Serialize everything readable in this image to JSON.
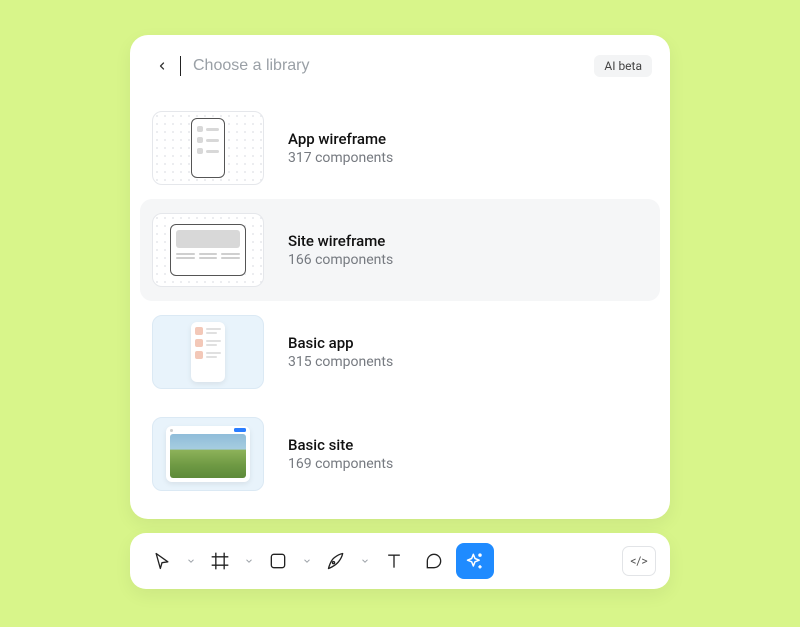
{
  "header": {
    "placeholder": "Choose a library",
    "beta_label": "AI beta"
  },
  "libraries": [
    {
      "title": "App wireframe",
      "count": "317 components"
    },
    {
      "title": "Site wireframe",
      "count": "166 components"
    },
    {
      "title": "Basic app",
      "count": "315 components"
    },
    {
      "title": "Basic site",
      "count": "169 components"
    }
  ],
  "toolbar": {
    "tools": [
      "select",
      "frame",
      "rectangle",
      "pen",
      "text",
      "comment",
      "ai"
    ],
    "code_label": "</>"
  }
}
